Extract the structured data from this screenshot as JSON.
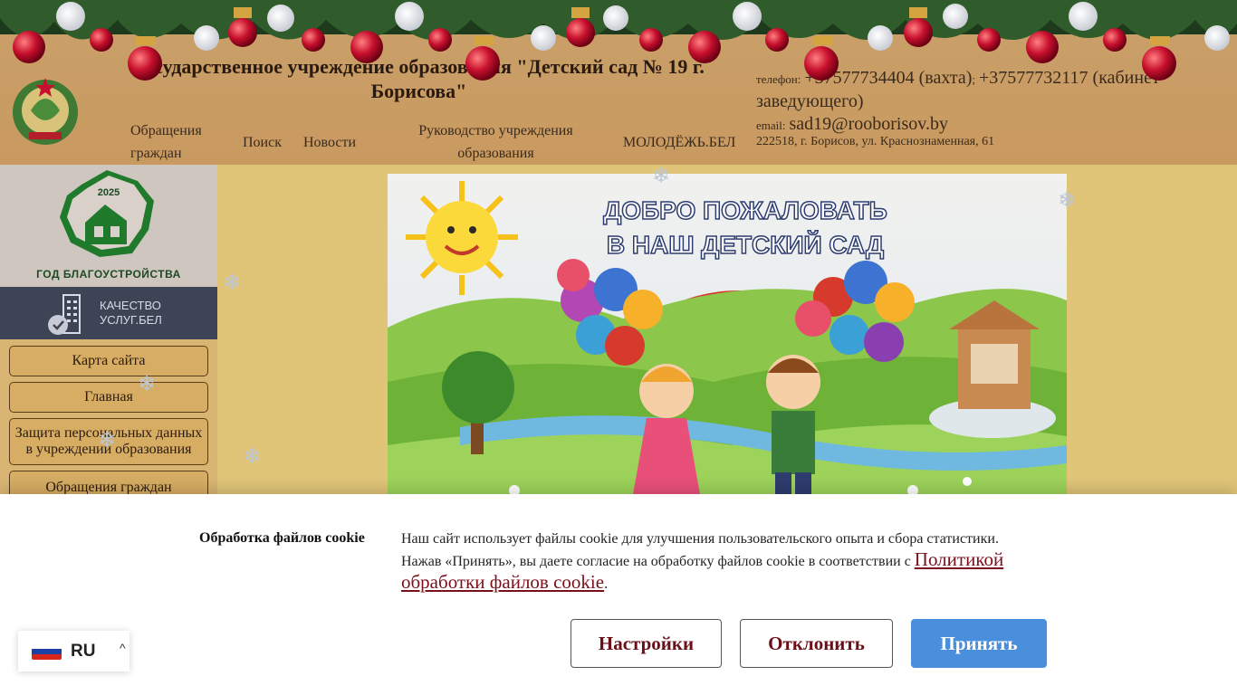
{
  "header": {
    "title": "Государственное учреждение образования \"Детский сад № 19 г. Борисова\"",
    "nav": {
      "appeals": "Обращения граждан",
      "search": "Поиск",
      "news": "Новости",
      "management": "Руководство учреждения образования",
      "youth": "МОЛОДЁЖЬ.БЕЛ"
    },
    "contacts": {
      "phone_label": "телефон:",
      "phone_1": "+37577734404 (вахта)",
      "separator": ";",
      "phone_2": "+37577732117 (кабинет заведующего)",
      "email_label": "email:",
      "email": "sad19@rooborisov.by",
      "address": "222518, г. Борисов, ул. Краснознаменная, 61"
    }
  },
  "sidebar": {
    "year_number": "2025",
    "year_caption": "ГОД БЛАГОУСТРОЙСТВА",
    "quality_line1": "КАЧЕСТВО",
    "quality_line2": "УСЛУГ.БЕЛ",
    "items": [
      {
        "label": "Карта сайта"
      },
      {
        "label": "Главная"
      },
      {
        "label": "Защита персональных данных в учреждении образования"
      },
      {
        "label": "Обращения граждан"
      }
    ]
  },
  "main": {
    "welcome_line1": "ДОБРО ПОЖАЛОВАТЬ",
    "welcome_line2": "В НАШ ДЕТСКИЙ САД"
  },
  "cookie": {
    "title": "Обработка файлов cookie",
    "text_1": "Наш сайт использует файлы cookie для улучшения пользовательского опыта и сбора статистики. Нажав «Принять», вы даете согласие на обработку файлов cookie в соответствии с",
    "link": "Политикой обработки файлов cookie",
    "text_end": ".",
    "settings": "Настройки",
    "decline": "Отклонить",
    "accept": "Принять"
  },
  "language": {
    "code": "RU",
    "flag_icon": "russia-flag-icon",
    "chevron_icon": "chevron-up-icon"
  },
  "colors": {
    "header_bg": "#c99a60",
    "quality_bg": "#3d4455",
    "accept_btn": "#4a8fdc",
    "link": "#7a0f1b"
  }
}
